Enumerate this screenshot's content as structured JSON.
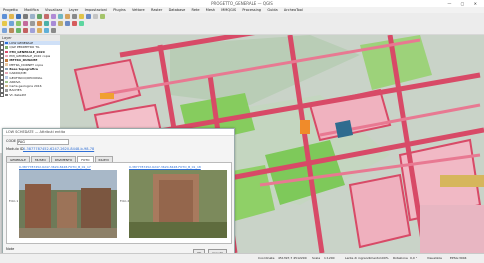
{
  "titlebar": {
    "title": "PROGETTO_GENERALE — QGIS",
    "controls": "— ▢ ✕"
  },
  "menu": [
    "Progetto",
    "Modifica",
    "Visualizza",
    "Layer",
    "Impostazioni",
    "Plugins",
    "Vettore",
    "Raster",
    "Database",
    "Rete",
    "Mesh",
    "MMQGIS",
    "Processing",
    "Guida",
    "ArcheoTool"
  ],
  "layers_panel": {
    "header": "Layer",
    "items": [
      {
        "label": "LOW GENERALE",
        "color": "#2f6fd6",
        "selected": true
      },
      {
        "label": "QGP PERIMETRO TIL",
        "color": "#7fae6b"
      },
      {
        "label": "PMI_GENERALE_2020",
        "color": "#d44d6a"
      },
      {
        "label": "PMI_GENERALE_2020 copia",
        "color": "#e7a6b4"
      },
      {
        "label": "METRA_DUNAME",
        "color": "#c07a3c"
      },
      {
        "label": "METRA_DORNET copia",
        "color": "#e8c7a2"
      },
      {
        "label": "Base topografica",
        "color": "#8aa0b4"
      },
      {
        "label": "CARDO/DEI",
        "color": "#e2a6b6"
      },
      {
        "label": "GEOFISICO/OPCIONAL",
        "color": "#b6c7e3"
      },
      {
        "label": "ARRIVA",
        "color": "#9ec289"
      },
      {
        "label": "Carta geologica 2016",
        "color": "#cfb58b"
      },
      {
        "label": "BACHES",
        "color": "#9a9a9a"
      },
      {
        "label": "Vt. Rete2M",
        "color": "#7d7d7d"
      }
    ]
  },
  "dialog": {
    "title": "LOW SCHEDATE — Attributi entita",
    "field_label": "CODE",
    "field_value": "PAG",
    "modulo_label": "Modulo ID",
    "modulo_value": "0-3877787452-6247-2620-8448-b-98-78",
    "tabs": [
      "GENERALE",
      "MUSEO",
      "PAVIMENTO",
      "FOTO",
      "RILIEVI"
    ],
    "active_tab": "FOTO",
    "photo1_link": "0-3877787452-6247-3620-8448-FOTO_B_01_17",
    "photo2_link": "0-3877787452-6247-3620-8448-FOTO_B_01_18",
    "photo1_label": "Foto 1",
    "photo2_label": "Foto 2",
    "footer_left": "Note",
    "ok_label": "OK",
    "cancel_label": "Annulla"
  },
  "status": {
    "coordinate_label": "Coordinate",
    "coordinate_value": "451397,7 4512290",
    "scale_label": "Scala",
    "scale_value": "1:1200",
    "magnifier_label": "Lente di ingrandimento",
    "magnifier_value": "100%",
    "rotation_label": "Rotazione",
    "rotation_value": "0,0 °",
    "render_label": "Visualizza",
    "crs_value": "EPSG:3004"
  },
  "colors": {
    "map_background": "#c7d0c6",
    "building_red": "#d84a67",
    "building_pink": "#f0b2bf",
    "garden_green": "#7ec95a",
    "accent_blue": "#2f6fd6"
  }
}
